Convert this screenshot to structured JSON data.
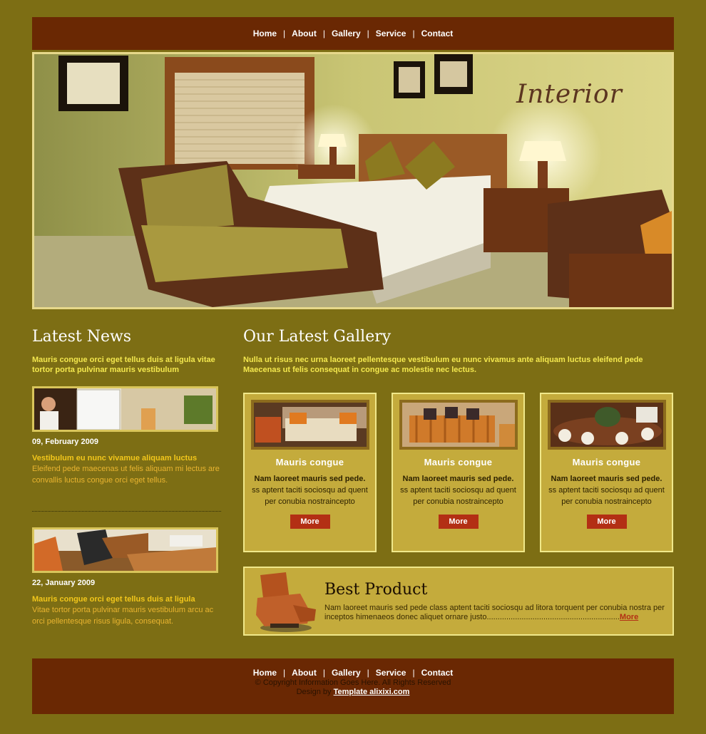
{
  "nav": {
    "items": [
      "Home",
      "About",
      "Gallery",
      "Service",
      "Contact"
    ],
    "separator": "|"
  },
  "hero": {
    "title": "Interior"
  },
  "latest_news": {
    "heading": "Latest News",
    "intro": "Mauris congue orci eget tellus duis at ligula vitae tortor porta pulvinar mauris vestibulum",
    "items": [
      {
        "date": "09, February 2009",
        "title": "Vestibulum eu nunc vivamue aliquam luctus",
        "body": "Eleifend pede maecenas ut felis aliquam mi lectus are convallis luctus congue orci eget tellus."
      },
      {
        "date": "22, January 2009",
        "title": "Mauris congue orci eget tellus duis at ligula",
        "body": "Vitae tortor porta pulvinar mauris vestibulum arcu ac orci pellentesque risus ligula, consequat."
      }
    ]
  },
  "gallery": {
    "heading": "Our Latest Gallery",
    "intro": "Nulla ut risus nec urna laoreet pellentesque vestibulum eu nunc vivamus ante aliquam luctus eleifend pede Maecenas ut felis consequat in congue ac molestie nec lectus.",
    "cards": [
      {
        "title": "Mauris congue",
        "bold": "Nam laoreet mauris sed pede.",
        "body": " ss aptent taciti sociosqu ad quent per conubia nostraincepto",
        "button": "More"
      },
      {
        "title": "Mauris congue",
        "bold": "Nam laoreet mauris sed pede.",
        "body": " ss aptent taciti sociosqu ad quent per conubia nostraincepto",
        "button": "More"
      },
      {
        "title": "Mauris congue",
        "bold": "Nam laoreet mauris sed pede.",
        "body": " ss aptent taciti sociosqu ad quent per conubia nostraincepto",
        "button": "More"
      }
    ]
  },
  "best_product": {
    "title": "Best Product",
    "body": "Nam laoreet mauris sed pede class aptent taciti sociosqu ad litora torquent per conubia nostra per inceptos himenaeos donec aliquet ornare justo.............................................................",
    "more": "More"
  },
  "footer": {
    "nav": [
      "Home",
      "About",
      "Gallery",
      "Service",
      "Contact"
    ],
    "copyright": "© Copyright Information Goes Here. All Rights Reserved",
    "design_prefix": "Design by",
    "design_link": "Template alixixi.com"
  },
  "colors": {
    "page_bg": "#7d6e14",
    "bar": "#6a2803",
    "card_bg": "#c4ab3c",
    "accent_button": "#b32f14"
  }
}
